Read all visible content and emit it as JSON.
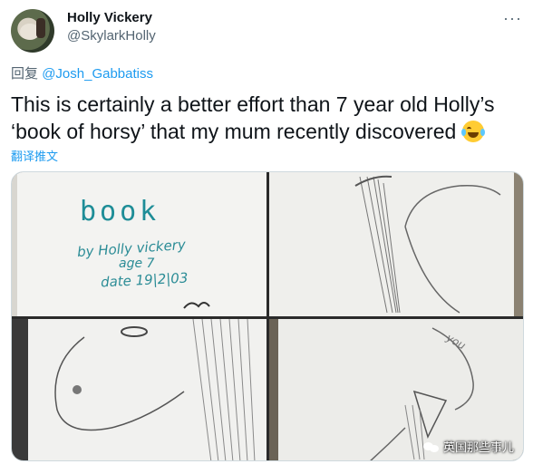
{
  "author": {
    "name": "Holly Vickery",
    "handle": "@SkylarkHolly"
  },
  "header": {
    "more_label": "···"
  },
  "reply": {
    "prefix": "回复",
    "mention": "@Josh_Gabbatiss"
  },
  "tweet": {
    "text": "This is certainly a better effort than 7 year old Holly’s ‘book of horsy’ that my mum recently discovered",
    "emoji": "face-with-tears-of-joy",
    "translate_label": "翻译推文"
  },
  "media": {
    "photo1": {
      "title": "book",
      "line1": "by Holly vickery",
      "line2": "age 7",
      "line3": "date 19|2|03"
    },
    "photo4": {
      "word": "you"
    }
  },
  "watermark": {
    "text": "英国那些事儿"
  },
  "colors": {
    "link": "#1d9bf0",
    "secondary": "#536471",
    "text": "#0f1419"
  }
}
